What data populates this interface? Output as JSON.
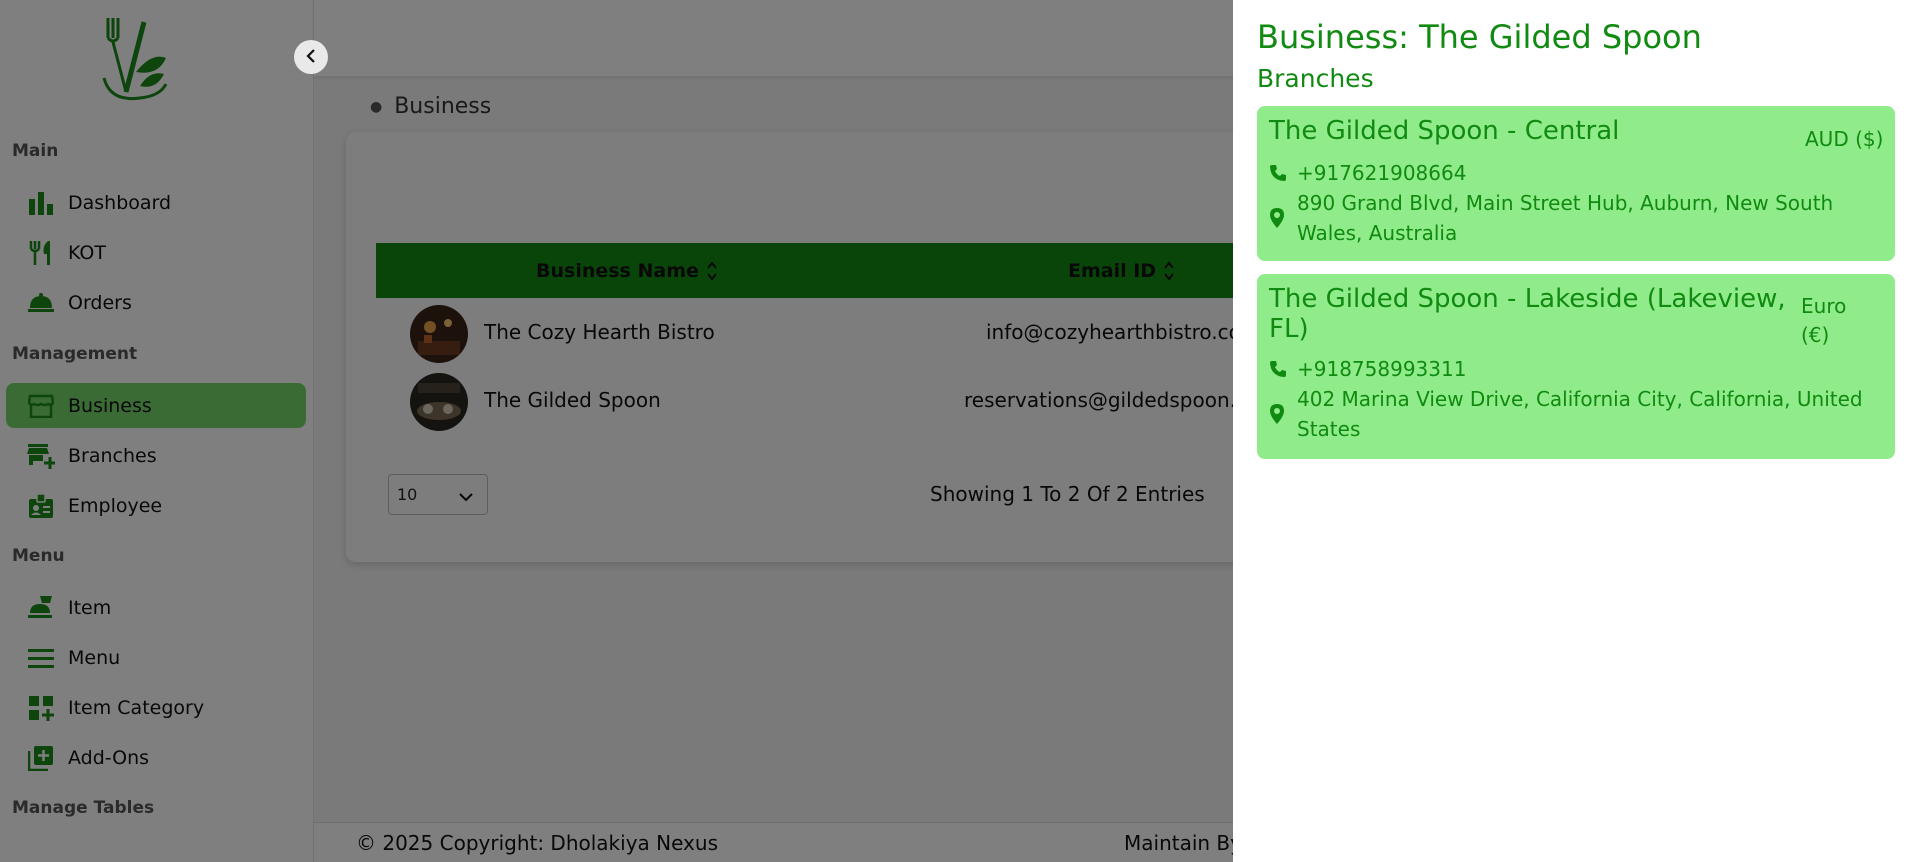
{
  "sidebar": {
    "sections": {
      "main": "Main",
      "management": "Management",
      "menu": "Menu",
      "manage_tables": "Manage Tables"
    },
    "items": [
      {
        "label": "Dashboard",
        "icon": "bar-chart-icon"
      },
      {
        "label": "KOT",
        "icon": "fork-knife-icon"
      },
      {
        "label": "Orders",
        "icon": "cloche-icon"
      },
      {
        "label": "Business",
        "icon": "storefront-icon",
        "active": true
      },
      {
        "label": "Branches",
        "icon": "add-store-icon"
      },
      {
        "label": "Employee",
        "icon": "id-badge-icon"
      },
      {
        "label": "Item",
        "icon": "food-icon"
      },
      {
        "label": "Menu",
        "icon": "list-icon"
      },
      {
        "label": "Item Category",
        "icon": "category-icon"
      },
      {
        "label": "Add-Ons",
        "icon": "add-box-icon"
      }
    ]
  },
  "breadcrumb": "Business",
  "table": {
    "columns": [
      "Business Name",
      "Email ID"
    ],
    "rows": [
      {
        "name": "The Cozy Hearth Bistro",
        "email": "info@cozyhearthbistro.co"
      },
      {
        "name": "The Gilded Spoon",
        "email": "reservations@gildedspoon."
      }
    ]
  },
  "pagination": {
    "page_size": "10",
    "showing": "Showing 1 To 2 Of 2 Entries"
  },
  "footer": {
    "copyright": "© 2025 Copyright: Dholakiya Nexus",
    "maintain": "Maintain By"
  },
  "drawer": {
    "title": "Business: The Gilded Spoon",
    "subtitle": "Branches",
    "branches": [
      {
        "name": "The Gilded Spoon - Central",
        "currency": "AUD ($)",
        "phone": "+917621908664",
        "address_line1": "890 Grand Blvd, Main Street Hub, Auburn, New South",
        "address_line2": "Wales, Australia"
      },
      {
        "name_line1": "The Gilded Spoon - Lakeside (Lakeview,",
        "name_line2": "FL)",
        "currency_line1": "Euro",
        "currency_line2": "(€)",
        "phone": "+918758993311",
        "address_line1": "402 Marina View Drive, California City, California, United",
        "address_line2": "States"
      }
    ]
  },
  "colors": {
    "brand_green": "#118a11",
    "table_header": "#128a12",
    "active_nav": "#75d66a",
    "branch_card": "#90ec8a"
  }
}
